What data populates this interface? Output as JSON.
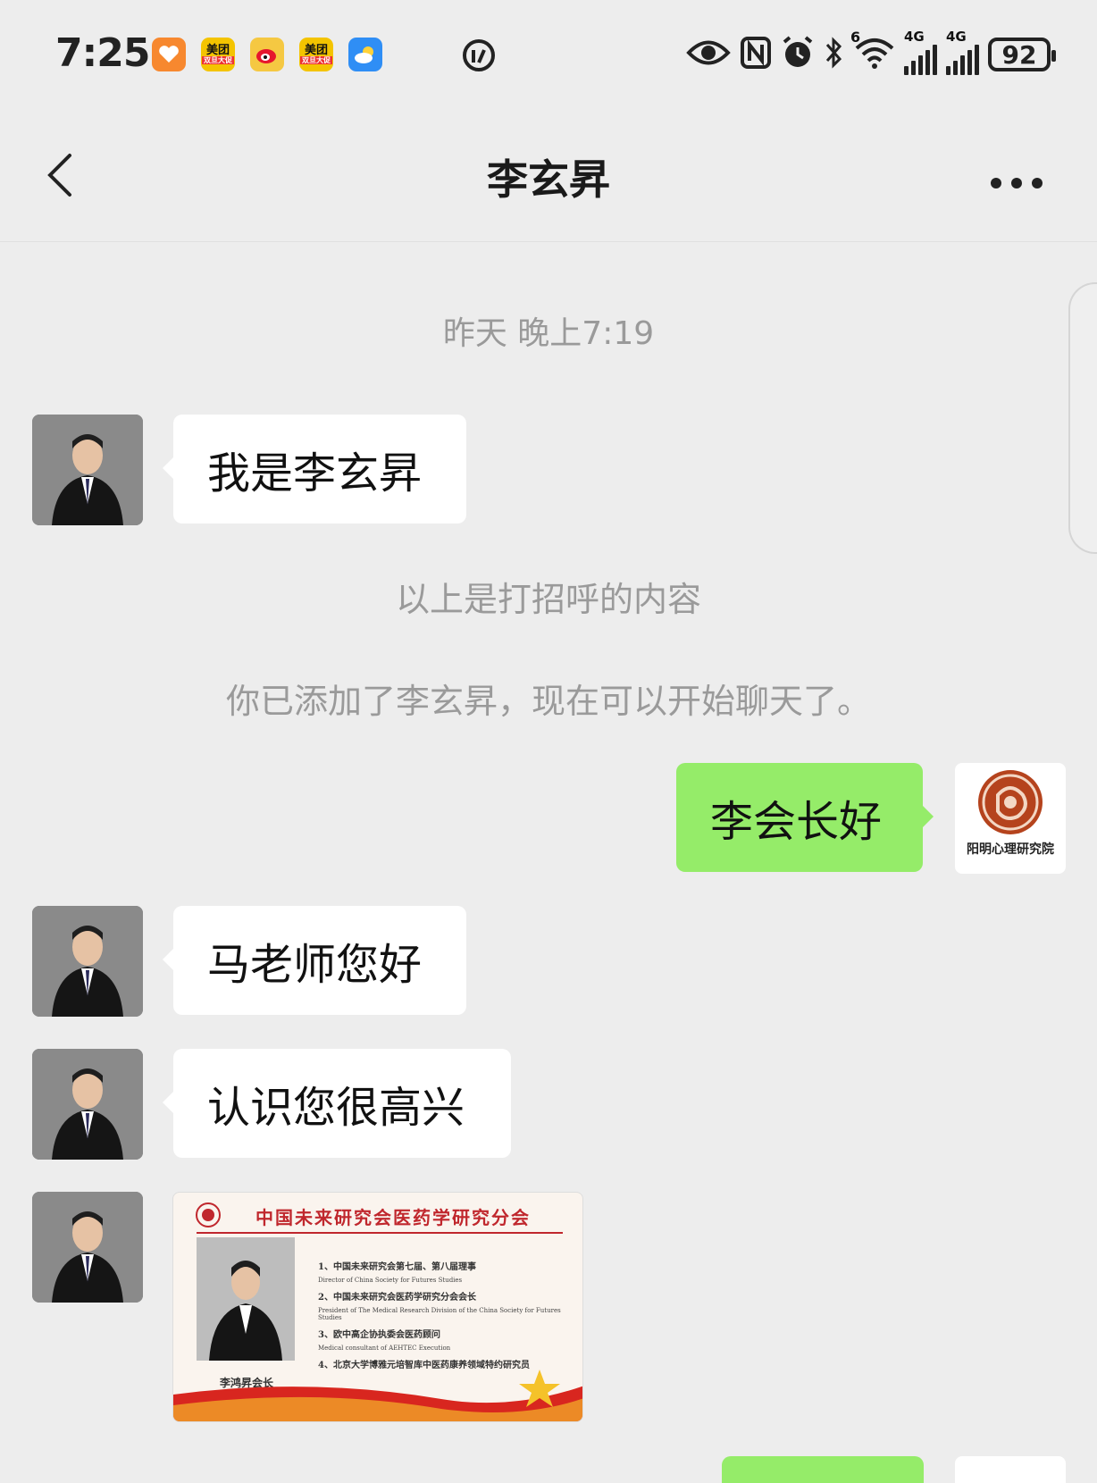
{
  "status_bar": {
    "time": "7:25",
    "apps": [
      {
        "icon": "heart-app-icon",
        "color": "#f7882f"
      },
      {
        "icon": "meituan-icon",
        "label": "美团",
        "sub": "双旦大促",
        "color": "#f4c400"
      },
      {
        "icon": "weibo-icon",
        "color": "#f5c842"
      },
      {
        "icon": "meituan-icon",
        "label": "美团",
        "sub": "双旦大促",
        "color": "#f4c400"
      },
      {
        "icon": "weather-icon",
        "color": "#2f8ef5"
      }
    ],
    "network_1": "4G",
    "network_2": "4G",
    "wifi_badge": "6",
    "battery": "92"
  },
  "header": {
    "title": "李玄昇"
  },
  "messages": {
    "timestamp": "昨天 晚上7:19",
    "m1": "我是李玄昇",
    "system_1": "以上是打招呼的内容",
    "system_2": "你已添加了李玄昇，现在可以开始聊天了。",
    "m2_out": "李会长好",
    "m3": "马老师您好",
    "m4": "认识您很高兴"
  },
  "self_avatar": {
    "logo_text": "阳明心理研究院"
  },
  "card": {
    "title": "中国未来研究会医药学研究分会",
    "items": [
      {
        "cn": "1、中国未来研究会第七届、第八届理事",
        "en": "Director of China Society for Futures Studies"
      },
      {
        "cn": "2、中国未来研究会医药学研究分会会长",
        "en": "President of The Medical Research Division of the China Society for Futures Studies"
      },
      {
        "cn": "3、欧中高企协执委会医药顾问",
        "en": "Medical consultant of AEHTEC Execution"
      },
      {
        "cn": "4、北京大学博雅元培智库中医药康养领域特约研究员",
        "en": ""
      }
    ],
    "name": "李鸿昇会长"
  },
  "colors": {
    "background": "#ededed",
    "bubble_out": "#95ec69",
    "bubble_in": "#ffffff",
    "system_text": "#9a9a9a"
  }
}
